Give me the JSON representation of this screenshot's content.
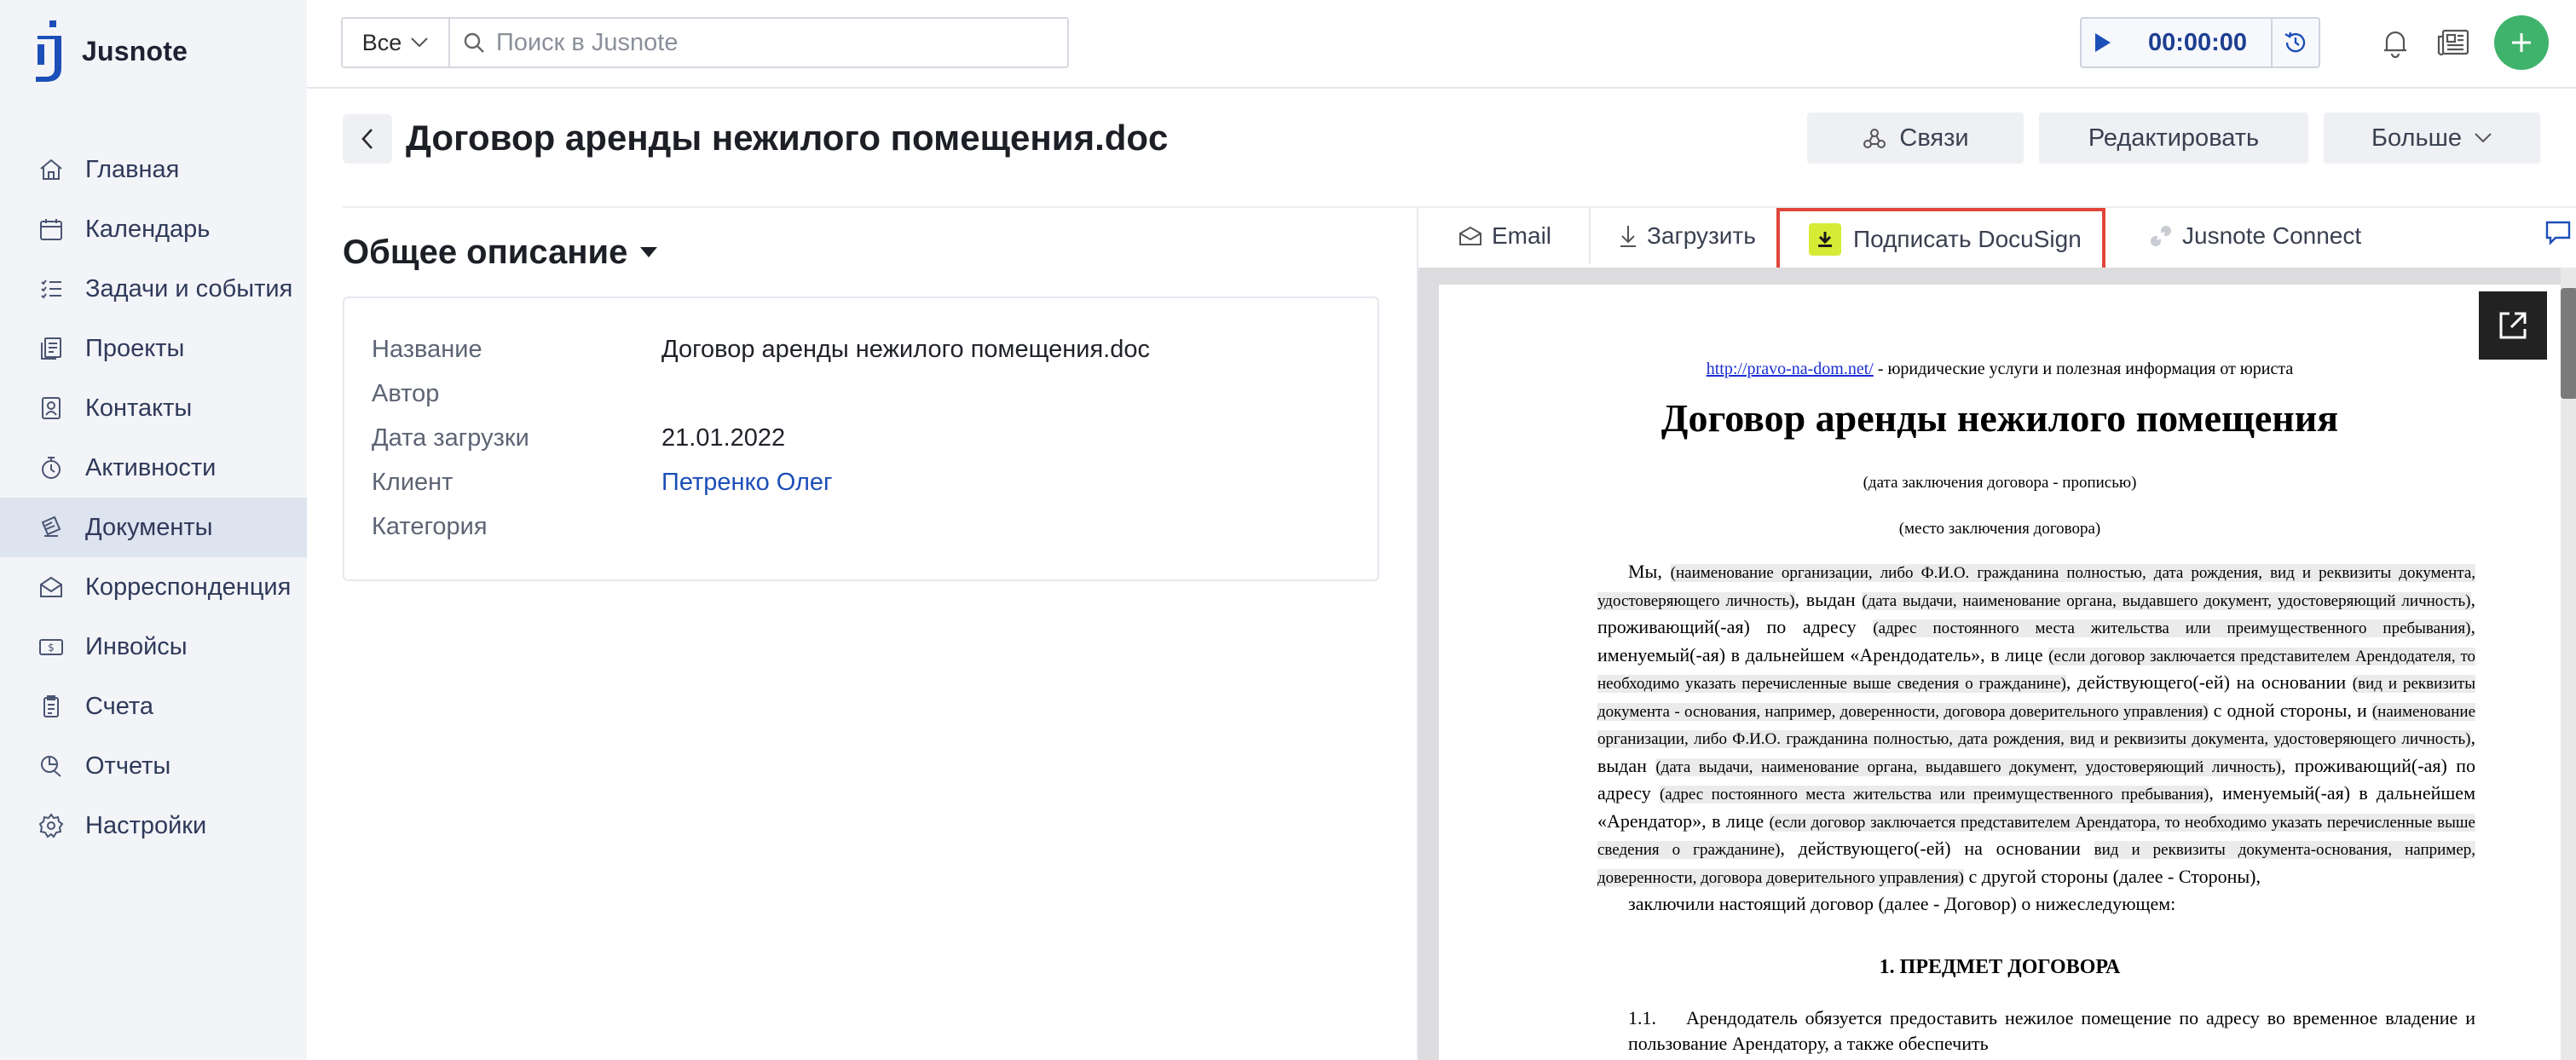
{
  "app": {
    "name": "Jusnote",
    "brand_color": "#1d4fb8",
    "accent_green": "#3fb36b"
  },
  "sidebar": {
    "items": [
      {
        "label": "Главная",
        "icon": "home-icon"
      },
      {
        "label": "Календарь",
        "icon": "calendar-icon"
      },
      {
        "label": "Задачи и события",
        "icon": "tasks-icon"
      },
      {
        "label": "Проекты",
        "icon": "projects-icon"
      },
      {
        "label": "Контакты",
        "icon": "contacts-icon"
      },
      {
        "label": "Активности",
        "icon": "activity-icon"
      },
      {
        "label": "Документы",
        "icon": "documents-icon",
        "active": true
      },
      {
        "label": "Корреспонденция",
        "icon": "correspondence-icon"
      },
      {
        "label": "Инвойсы",
        "icon": "invoice-icon"
      },
      {
        "label": "Счета",
        "icon": "accounts-icon"
      },
      {
        "label": "Отчеты",
        "icon": "reports-icon"
      },
      {
        "label": "Настройки",
        "icon": "settings-icon"
      }
    ]
  },
  "topbar": {
    "scope": "Все",
    "search_placeholder": "Поиск в Jusnote",
    "timer": "00:00:00"
  },
  "header": {
    "title": "Договор аренды нежилого помещения.doc",
    "links_button": "Связи",
    "edit_button": "Редактировать",
    "more_button": "Больше"
  },
  "overview": {
    "title": "Общее описание",
    "fields": [
      {
        "label": "Название",
        "value": "Договор аренды нежилого помещения.doc"
      },
      {
        "label": "Автор",
        "value": ""
      },
      {
        "label": "Дата загрузки",
        "value": "21.01.2022"
      },
      {
        "label": "Клиент",
        "value": "Петренко Олег"
      },
      {
        "label": "Категория",
        "value": ""
      }
    ]
  },
  "doc_toolbar": {
    "email": "Email",
    "download": "Загрузить",
    "docusign": "Подписать DocuSign",
    "connect": "Jusnote Connect"
  },
  "document": {
    "source_link": "http://pravo-na-dom.net/",
    "source_text": " -  юридические услуги и полезная информация от юриста",
    "title": "Договор аренды нежилого помещения",
    "date_note": "(дата заключения договора - прописью)",
    "place_note": "(место заключения договора)",
    "body": [
      {
        "t": "Мы, "
      },
      {
        "t": "(наименование организации, либо Ф.И.О. гражданина полностью, дата рождения, вид и реквизиты документа, удостоверяющего личность)",
        "h": true
      },
      {
        "t": ", выдан "
      },
      {
        "t": "(дата выдачи, наименование органа, выдавшего документ, удостоверяющий личность)",
        "h": true
      },
      {
        "t": ", проживающий(-ая) по адресу "
      },
      {
        "t": "(адрес постоянного места жительства или преимущественного пребывания)",
        "h": true
      },
      {
        "t": ", именуемый(-ая) в дальнейшем «Арендодатель», в лице "
      },
      {
        "t": "(если договор заключается представителем Арендодателя, то необходимо указать перечисленные выше сведения о гражданине)",
        "h": true
      },
      {
        "t": ", действующего(-ей) на основании "
      },
      {
        "t": "(вид и реквизиты документа - основания, например, доверенности, договора доверительного управления)",
        "h": true
      },
      {
        "t": " с одной стороны, и "
      },
      {
        "t": "(наименование организации, либо Ф.И.О. гражданина полностью, дата рождения, вид и реквизиты документа, удостоверяющего личность)",
        "h": true
      },
      {
        "t": ", выдан "
      },
      {
        "t": "(дата выдачи, наименование органа, выдавшего документ, удостоверяющий личность)",
        "h": true
      },
      {
        "t": ", проживающий(-ая) по адресу "
      },
      {
        "t": "(адрес постоянного места жительства или преимущественного пребывания)",
        "h": true
      },
      {
        "t": ", именуемый(-ая) в дальнейшем «Арендатор», в лице "
      },
      {
        "t": "(если договор заключается представителем Арендатора, то необходимо указать перечисленные выше сведения о гражданине)",
        "h": true
      },
      {
        "t": ", действующего(-ей) на основании "
      },
      {
        "t": "вид и реквизиты документа-основания, например, доверенности, договора доверительного управления)",
        "h": true
      },
      {
        "t": " с другой стороны (далее - Стороны),"
      }
    ],
    "concluded": "заключили настоящий договор (далее - Договор) о нижеследующем:",
    "section1": "1. ПРЕДМЕТ ДОГОВОРА",
    "clause_num": "1.1.",
    "clause_text": "Арендодатель обязуется предоставить нежилое помещение по адресу во временное владение и пользование Арендатору, а также обеспечить"
  }
}
